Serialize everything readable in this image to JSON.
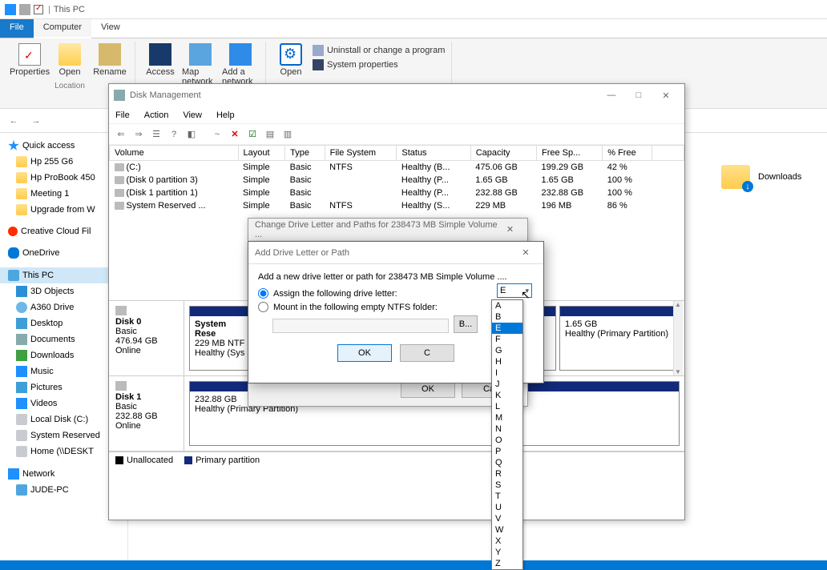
{
  "explorer": {
    "title": "This PC",
    "tabs": {
      "file": "File",
      "computer": "Computer",
      "view": "View"
    },
    "ribbon": {
      "properties": "Properties",
      "open": "Open",
      "rename": "Rename",
      "access": "Access",
      "mapnet": "Map network",
      "addnet": "Add a network",
      "open2": "Open",
      "uninstall": "Uninstall or change a program",
      "sysprops": "System properties",
      "group_location": "Location"
    },
    "sidebar": {
      "quick": "Quick access",
      "items": [
        "Hp 255 G6",
        "Hp ProBook 450",
        "Meeting 1",
        "Upgrade from W"
      ],
      "creative": "Creative Cloud Fil",
      "onedrive": "OneDrive",
      "thispc": "This PC",
      "pc_items": [
        "3D Objects",
        "A360 Drive",
        "Desktop",
        "Documents",
        "Downloads",
        "Music",
        "Pictures",
        "Videos",
        "Local Disk (C:)",
        "System Reserved",
        "Home (\\\\DESKT"
      ],
      "network": "Network",
      "judepc": "JUDE-PC"
    },
    "content": {
      "downloads": "Downloads"
    }
  },
  "dm": {
    "title": "Disk Management",
    "menu": [
      "File",
      "Action",
      "View",
      "Help"
    ],
    "columns": [
      "Volume",
      "Layout",
      "Type",
      "File System",
      "Status",
      "Capacity",
      "Free Sp...",
      "% Free"
    ],
    "rows": [
      {
        "vol": "(C:)",
        "layout": "Simple",
        "type": "Basic",
        "fs": "NTFS",
        "status": "Healthy (B...",
        "cap": "475.06 GB",
        "free": "199.29 GB",
        "pct": "42 %"
      },
      {
        "vol": "(Disk 0 partition 3)",
        "layout": "Simple",
        "type": "Basic",
        "fs": "",
        "status": "Healthy (P...",
        "cap": "1.65 GB",
        "free": "1.65 GB",
        "pct": "100 %"
      },
      {
        "vol": "(Disk 1 partition 1)",
        "layout": "Simple",
        "type": "Basic",
        "fs": "",
        "status": "Healthy (P...",
        "cap": "232.88 GB",
        "free": "232.88 GB",
        "pct": "100 %"
      },
      {
        "vol": "System Reserved ...",
        "layout": "Simple",
        "type": "Basic",
        "fs": "NTFS",
        "status": "Healthy (S...",
        "cap": "229 MB",
        "free": "196 MB",
        "pct": "86 %"
      }
    ],
    "disks": [
      {
        "name": "Disk 0",
        "type": "Basic",
        "size": "476.94 GB",
        "state": "Online",
        "parts": [
          {
            "title": "System Rese",
            "line2": "229 MB NTF",
            "line3": "Healthy (Sys"
          },
          {
            "title": "",
            "line2": "",
            "line3": ""
          },
          {
            "title": "",
            "line2": "1.65 GB",
            "line3": "Healthy (Primary Partition)"
          }
        ]
      },
      {
        "name": "Disk 1",
        "type": "Basic",
        "size": "232.88 GB",
        "state": "Online",
        "parts": [
          {
            "title": "",
            "line2": "232.88 GB",
            "line3": "Healthy (Primary Partition)"
          }
        ]
      }
    ],
    "legend": {
      "unalloc": "Unallocated",
      "primary": "Primary partition"
    }
  },
  "modal1": {
    "title": "Change Drive Letter and Paths for 238473 MB  Simple Volume ...",
    "ok": "OK",
    "cancel": "Ca"
  },
  "modal2": {
    "title": "Add Drive Letter or Path",
    "hint": "Add a new drive letter or path for 238473 MB  Simple Volume ....",
    "assign": "Assign the following drive letter:",
    "mount": "Mount in the following empty NTFS folder:",
    "browse": "B...",
    "ok": "OK",
    "cancel": "C",
    "selected_letter": "E"
  },
  "dropdown": {
    "options": [
      "A",
      "B",
      "E",
      "F",
      "G",
      "H",
      "I",
      "J",
      "K",
      "L",
      "M",
      "N",
      "O",
      "P",
      "Q",
      "R",
      "S",
      "T",
      "U",
      "V",
      "W",
      "X",
      "Y",
      "Z"
    ],
    "selected": "E"
  }
}
